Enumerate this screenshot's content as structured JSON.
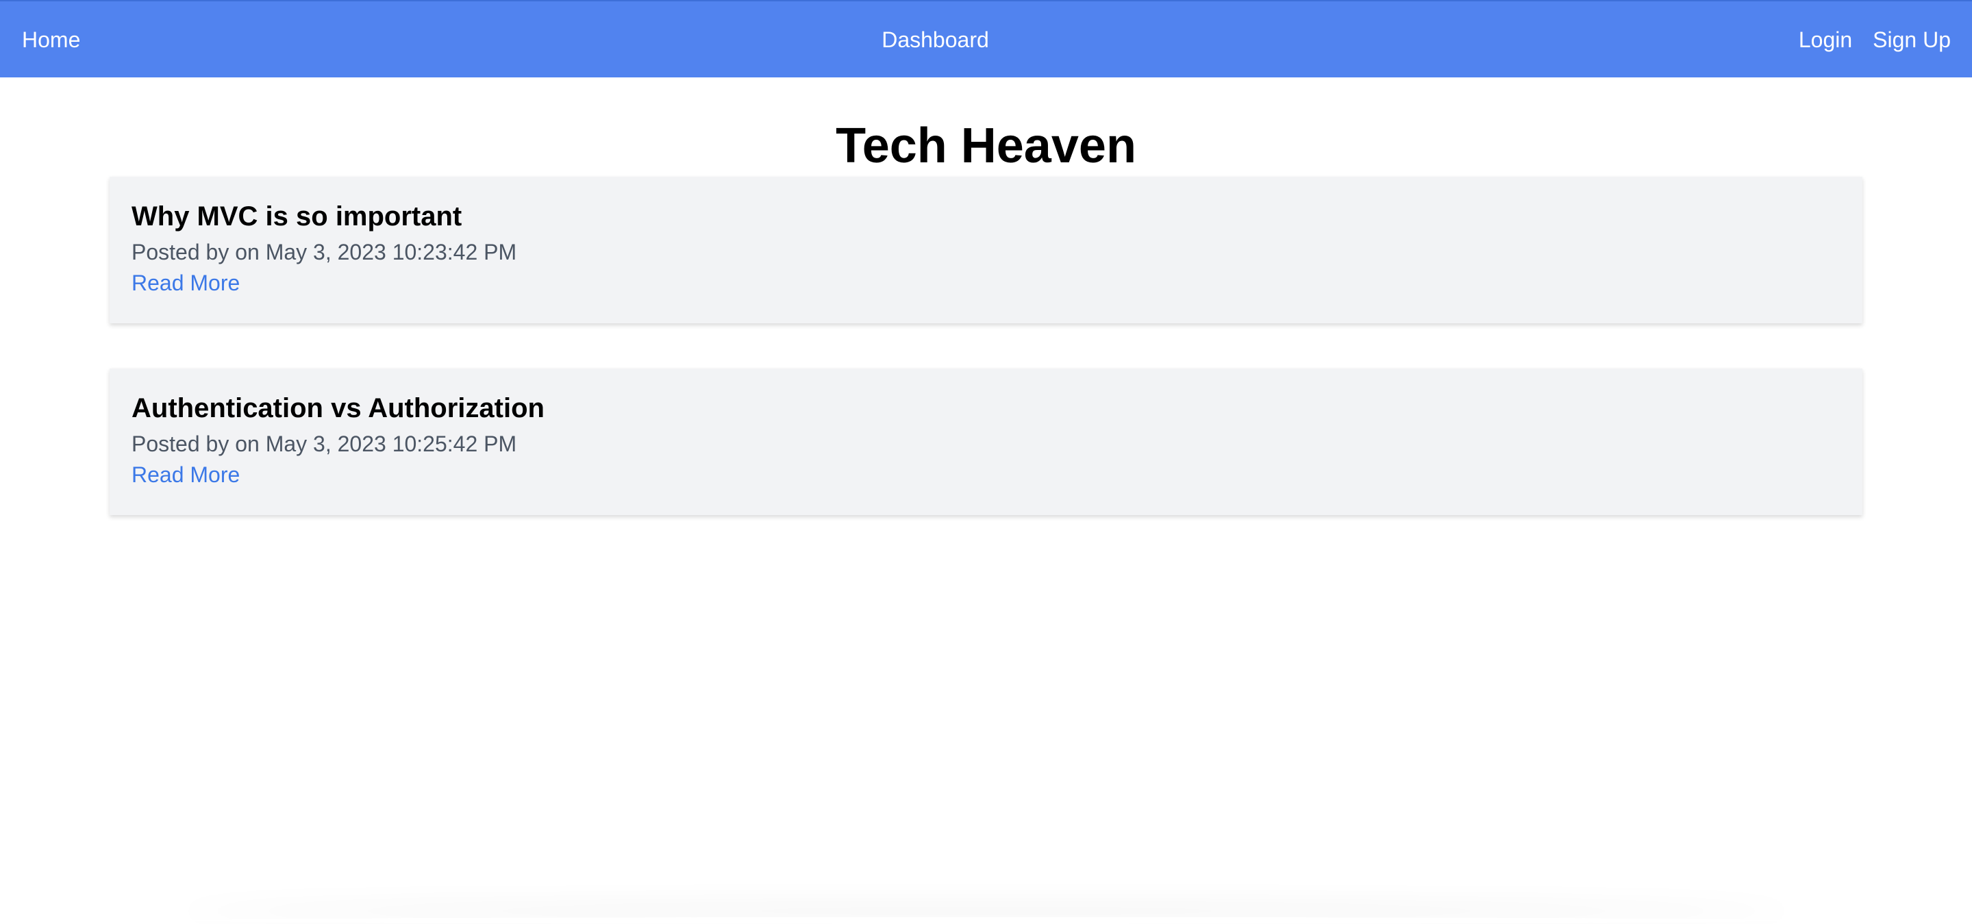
{
  "nav": {
    "home_label": "Home",
    "dashboard_label": "Dashboard",
    "login_label": "Login",
    "signup_label": "Sign Up"
  },
  "page": {
    "title": "Tech Heaven"
  },
  "posts": [
    {
      "title": "Why MVC is so important",
      "meta": "Posted by on May 3, 2023 10:23:42 PM",
      "link_label": "Read More"
    },
    {
      "title": "Authentication vs Authorization",
      "meta": "Posted by on May 3, 2023 10:25:42 PM",
      "link_label": "Read More"
    }
  ],
  "colors": {
    "navbar": "#5183ef",
    "card": "#f2f3f5",
    "link": "#3b78e7",
    "meta_text": "#4b5563"
  }
}
